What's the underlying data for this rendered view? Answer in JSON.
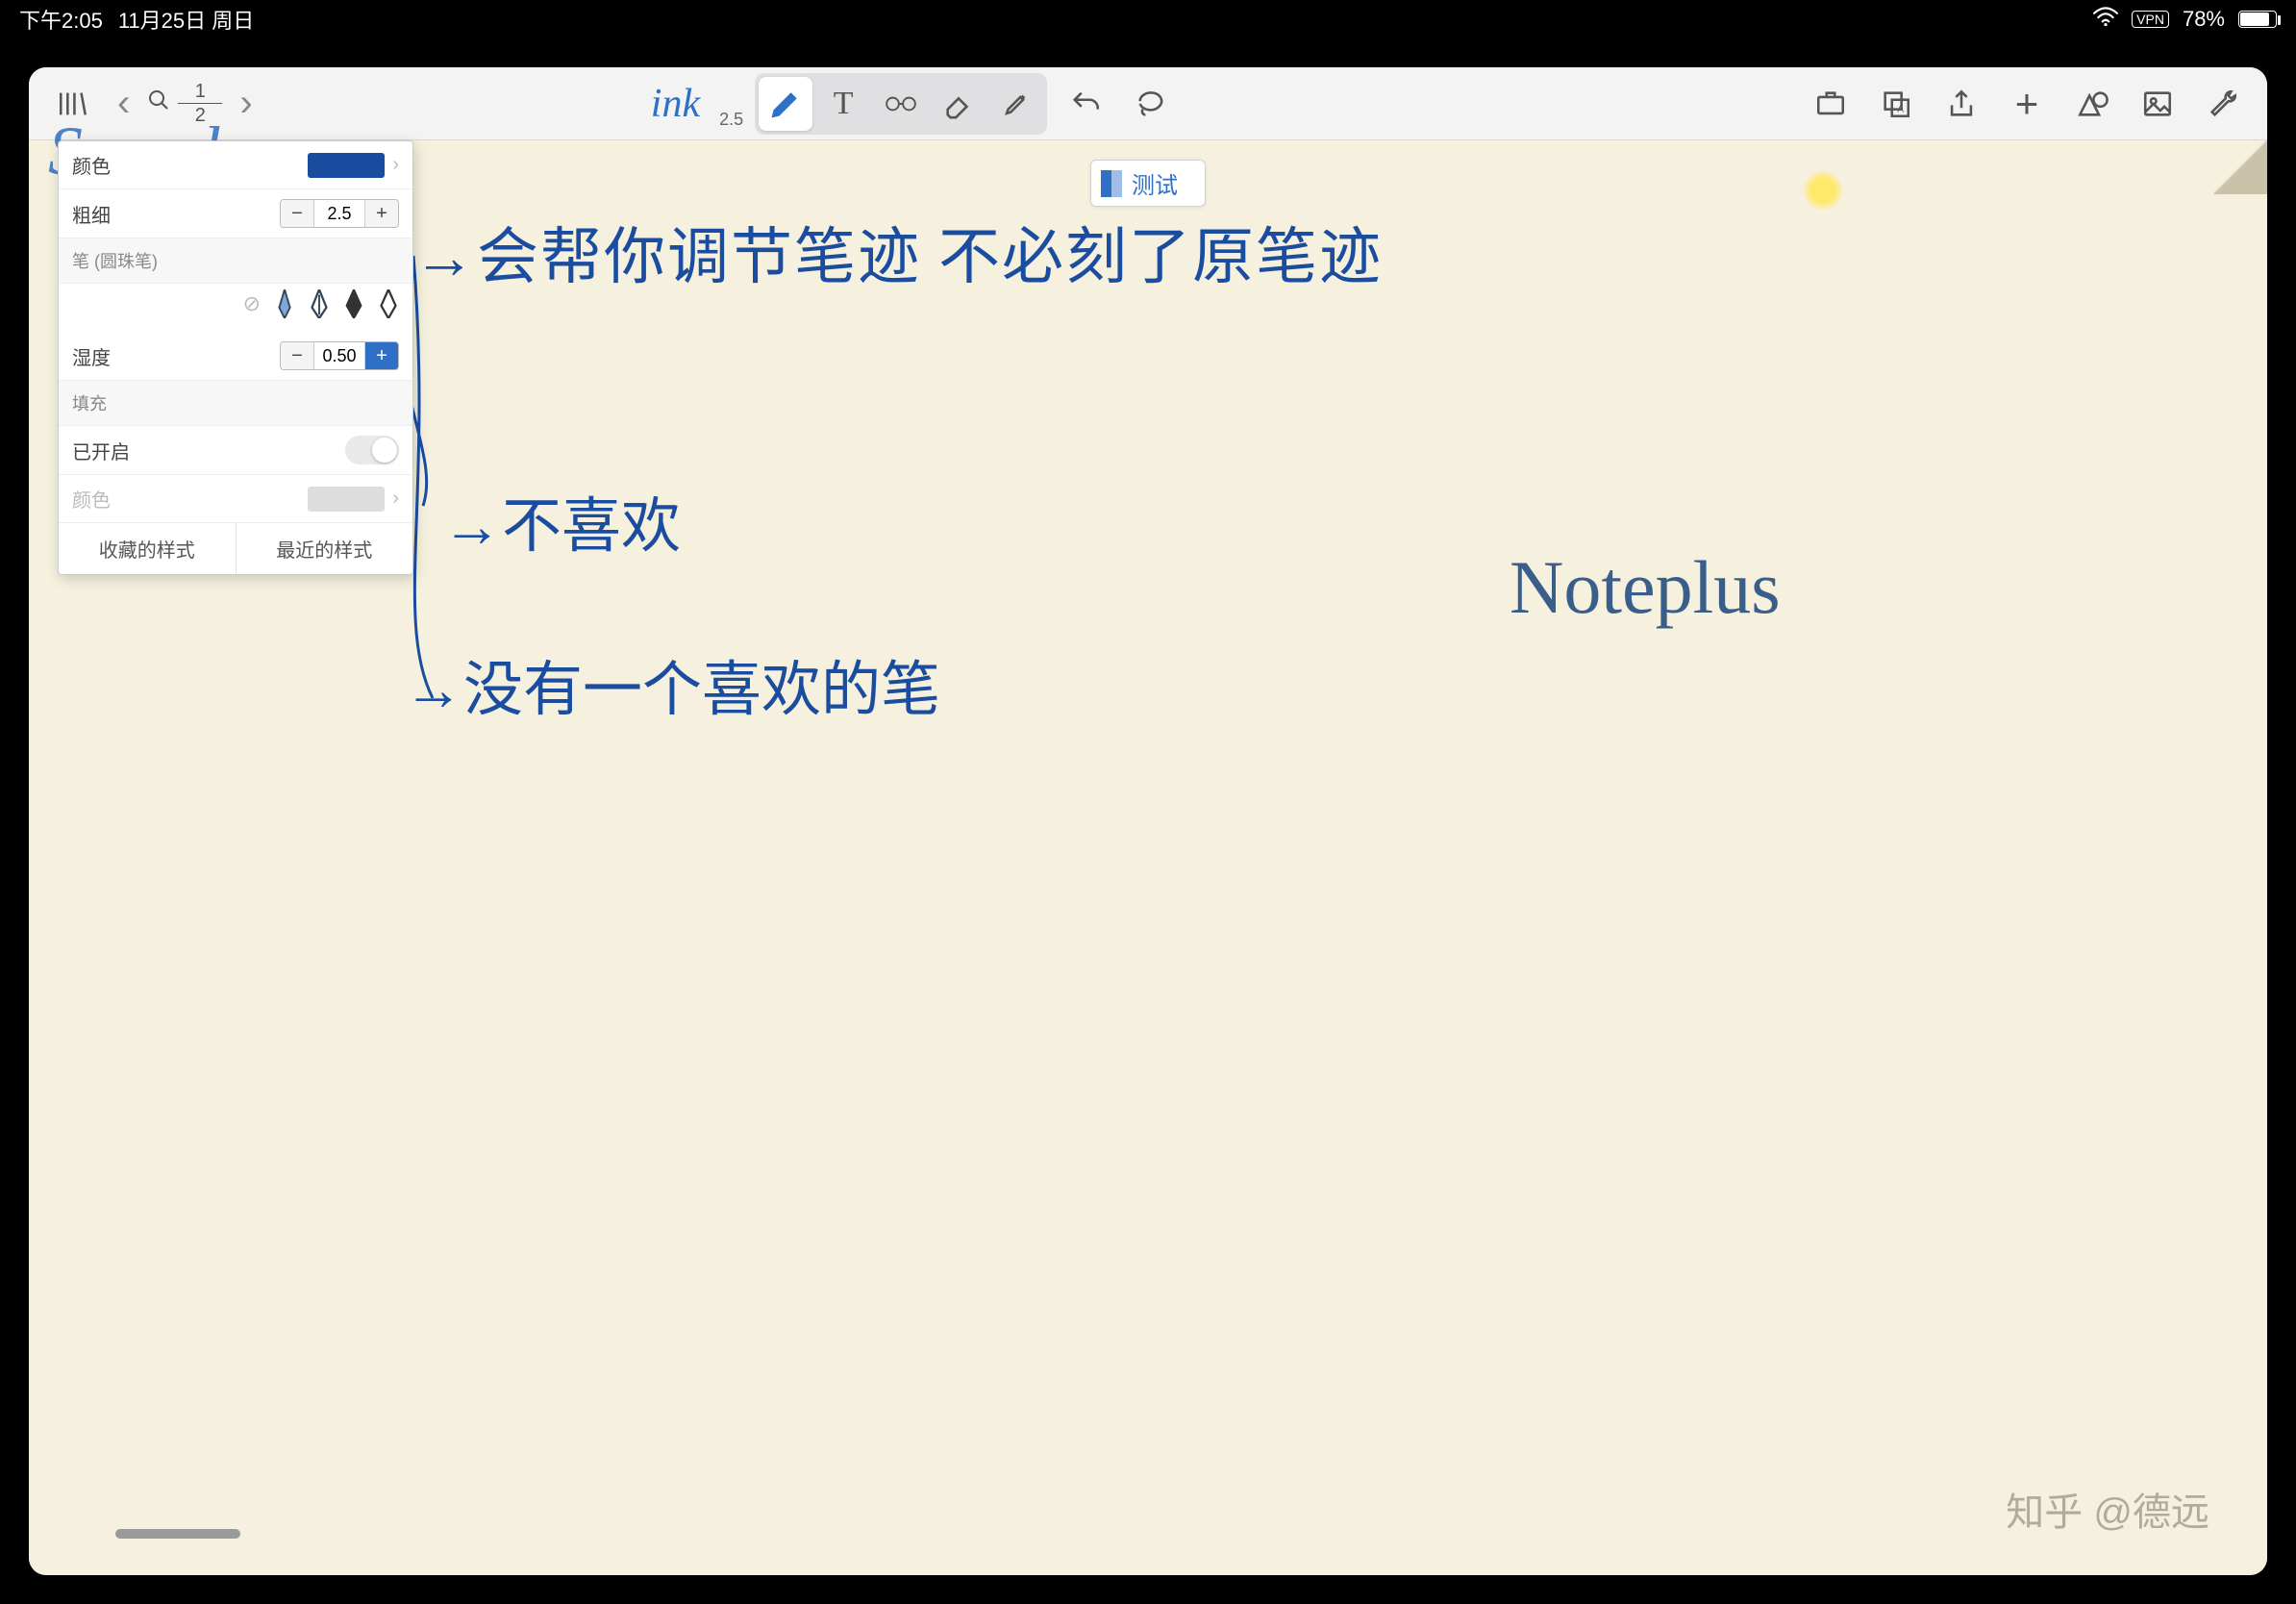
{
  "status": {
    "time": "下午2:05",
    "date": "11月25日 周日",
    "vpn": "VPN",
    "battery_pct": "78%"
  },
  "toolbar": {
    "page_current": "1",
    "page_total": "2",
    "ink_label": "ink",
    "ink_size": "2.5"
  },
  "tab": {
    "name": "测试"
  },
  "panel": {
    "sample": "Sample",
    "color_label": "颜色",
    "thickness_label": "粗细",
    "thickness_value": "2.5",
    "pen_label": "笔 (圆珠笔)",
    "humidity_label": "湿度",
    "humidity_value": "0.50",
    "fill_section": "填充",
    "enabled_label": "已开启",
    "color2_label": "颜色",
    "fav_styles": "收藏的样式",
    "recent_styles": "最近的样式"
  },
  "canvas": {
    "line1": "→会帮你调节笔迹 不必刻了原笔迹",
    "line2": "→不喜欢",
    "line3": "→没有一个喜欢的笔",
    "line4": "Noteplus"
  },
  "watermark": "知乎 @德远"
}
